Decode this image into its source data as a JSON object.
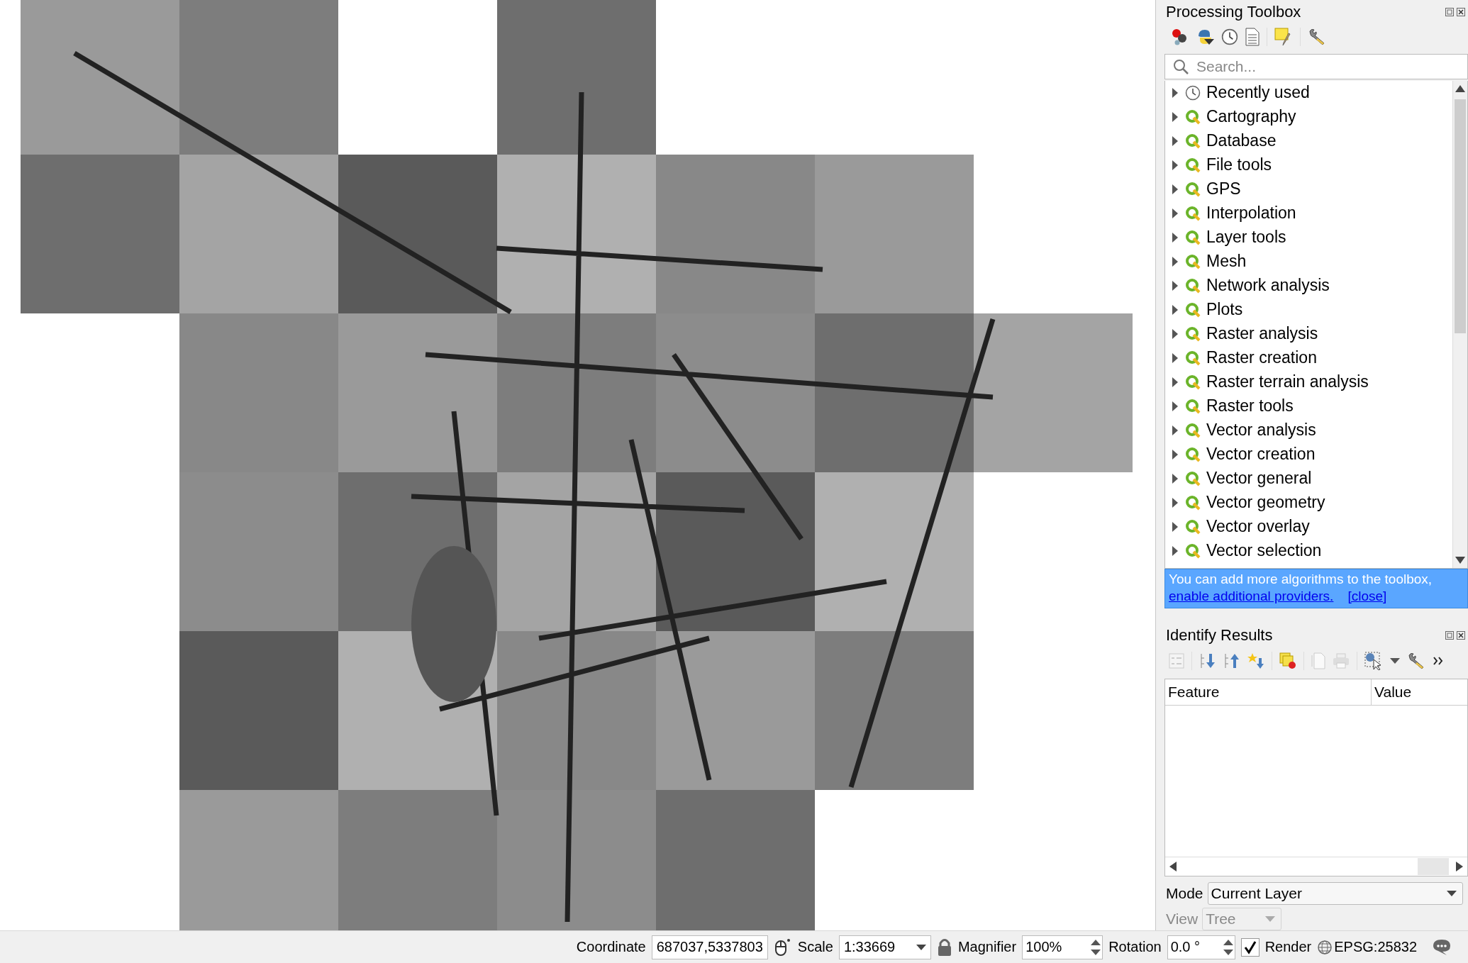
{
  "processing_toolbox": {
    "title": "Processing Toolbox",
    "search": {
      "placeholder": "Search..."
    },
    "items": [
      {
        "label": "Recently used",
        "kind": "recent",
        "expanded": false
      },
      {
        "label": "Cartography",
        "kind": "provider",
        "expanded": false
      },
      {
        "label": "Database",
        "kind": "provider",
        "expanded": false
      },
      {
        "label": "File tools",
        "kind": "provider",
        "expanded": false
      },
      {
        "label": "GPS",
        "kind": "provider",
        "expanded": false
      },
      {
        "label": "Interpolation",
        "kind": "provider",
        "expanded": false
      },
      {
        "label": "Layer tools",
        "kind": "provider",
        "expanded": false
      },
      {
        "label": "Mesh",
        "kind": "provider",
        "expanded": false
      },
      {
        "label": "Network analysis",
        "kind": "provider",
        "expanded": false
      },
      {
        "label": "Plots",
        "kind": "provider",
        "expanded": false
      },
      {
        "label": "Raster analysis",
        "kind": "provider",
        "expanded": false
      },
      {
        "label": "Raster creation",
        "kind": "provider",
        "expanded": false
      },
      {
        "label": "Raster terrain analysis",
        "kind": "provider",
        "expanded": false
      },
      {
        "label": "Raster tools",
        "kind": "provider",
        "expanded": false
      },
      {
        "label": "Vector analysis",
        "kind": "provider",
        "expanded": false
      },
      {
        "label": "Vector creation",
        "kind": "provider",
        "expanded": false
      },
      {
        "label": "Vector general",
        "kind": "provider",
        "expanded": false
      },
      {
        "label": "Vector geometry",
        "kind": "provider",
        "expanded": false
      },
      {
        "label": "Vector overlay",
        "kind": "provider",
        "expanded": false
      },
      {
        "label": "Vector selection",
        "kind": "provider",
        "expanded": false
      }
    ],
    "banner": {
      "text": "You can add more algorithms to the toolbox,",
      "link": "enable additional providers.",
      "close": "[close]"
    }
  },
  "identify_results": {
    "title": "Identify Results",
    "columns": [
      "Feature",
      "Value"
    ],
    "mode": {
      "label": "Mode",
      "value": "Current Layer"
    },
    "view": {
      "label": "View",
      "value": "Tree",
      "disabled": true
    }
  },
  "status_bar": {
    "coordinate": {
      "label": "Coordinate",
      "value": "687037,5337803"
    },
    "scale": {
      "label": "Scale",
      "value": "1:33669"
    },
    "magnifier": {
      "label": "Magnifier",
      "value": "100%"
    },
    "rotation": {
      "label": "Rotation",
      "value": "0.0 °"
    },
    "render": {
      "label": "Render",
      "checked": true
    },
    "crs": "EPSG:25832"
  }
}
